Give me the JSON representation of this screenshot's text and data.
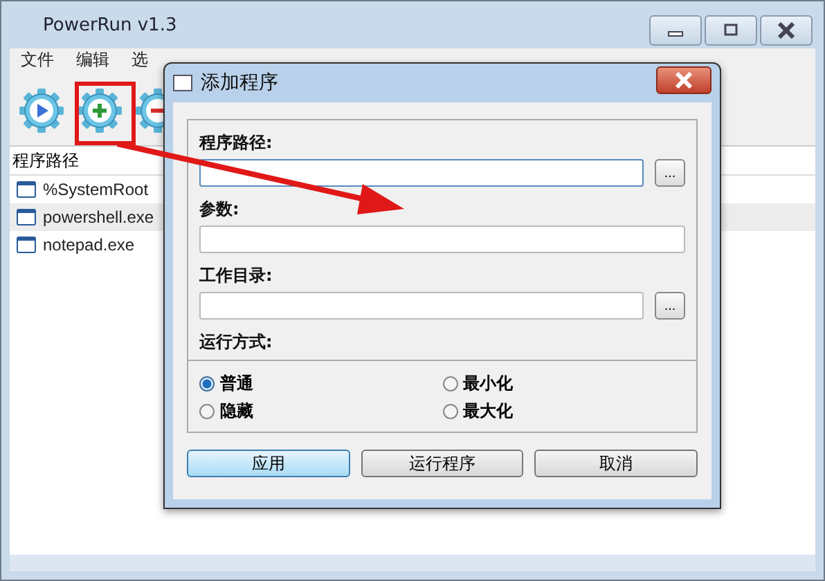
{
  "main_window": {
    "title": "PowerRun v1.3",
    "menu": [
      "文件",
      "编辑",
      "选"
    ],
    "toolbar": [
      {
        "kind": "run"
      },
      {
        "kind": "add"
      },
      {
        "kind": "remove"
      }
    ],
    "list": {
      "header": "程序路径",
      "rows": [
        {
          "text": "%SystemRoot",
          "selected": false
        },
        {
          "text": "powershell.exe",
          "selected": true
        },
        {
          "text": "notepad.exe",
          "selected": false
        }
      ]
    }
  },
  "dialog": {
    "title": "添加程序",
    "fields": [
      {
        "label": "程序路径:",
        "browse": "..."
      },
      {
        "label": "参数:"
      },
      {
        "label": "工作目录:",
        "browse": "..."
      }
    ],
    "run_mode": {
      "label": "运行方式:",
      "options": [
        {
          "label": "普通",
          "selected": true
        },
        {
          "label": "最小化",
          "selected": false
        },
        {
          "label": "隐藏",
          "selected": false
        },
        {
          "label": "最大化",
          "selected": false
        }
      ]
    },
    "buttons": [
      {
        "label": "应用",
        "default": true
      },
      {
        "label": "运行程序",
        "default": false
      },
      {
        "label": "取消",
        "default": false
      }
    ]
  }
}
